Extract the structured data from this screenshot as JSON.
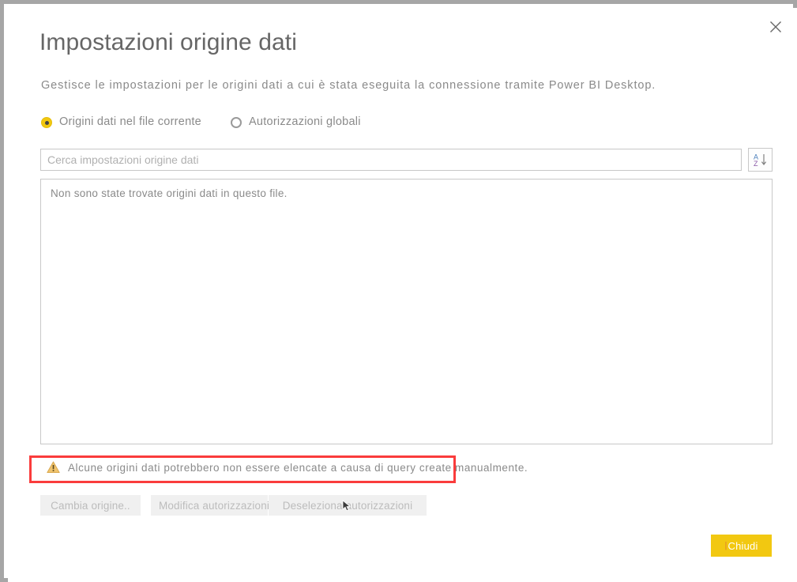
{
  "window": {
    "title": "Impostazioni origine dati",
    "subtitle": "Gestisce le impostazioni per le origini dati a cui è stata eseguita la connessione tramite Power BI Desktop.",
    "close_icon": "close-x-icon"
  },
  "radio_group": {
    "options": [
      {
        "label": "Origini dati nel file corrente",
        "selected": true
      },
      {
        "label": "Autorizzazioni globali",
        "selected": false
      }
    ]
  },
  "search": {
    "placeholder": "Cerca impostazioni origine dati",
    "value": "",
    "sort_button": {
      "icon": "sort-az-descending-icon",
      "letter_top": "A",
      "letter_bottom": "Z"
    }
  },
  "list": {
    "empty_message": "Non sono state trovate origini dati in questo file."
  },
  "warning": {
    "icon": "warning-triangle-icon",
    "text": "Alcune origini dati potrebbero non essere elencate a causa di query create manualmente.",
    "highlight_color": "#fa3c3c"
  },
  "actions": {
    "buttons": [
      {
        "label": "Cambia origine..",
        "enabled": false
      },
      {
        "label": "Modifica autorizzazioni...",
        "enabled": false
      },
      {
        "label": "Deseleziona autorizzazioni",
        "enabled": false
      }
    ]
  },
  "footer": {
    "close_label": "Chiudi",
    "close_accent": "#f2c811"
  },
  "colors": {
    "accent_yellow": "#f2c80f",
    "frame_gray": "#a6a6a6",
    "text_gray": "#8a8a8a",
    "title_gray": "#666666",
    "border_gray": "#c8c8c8",
    "disabled_bg": "#f0f0f0",
    "disabled_text": "#bcbcbc"
  }
}
